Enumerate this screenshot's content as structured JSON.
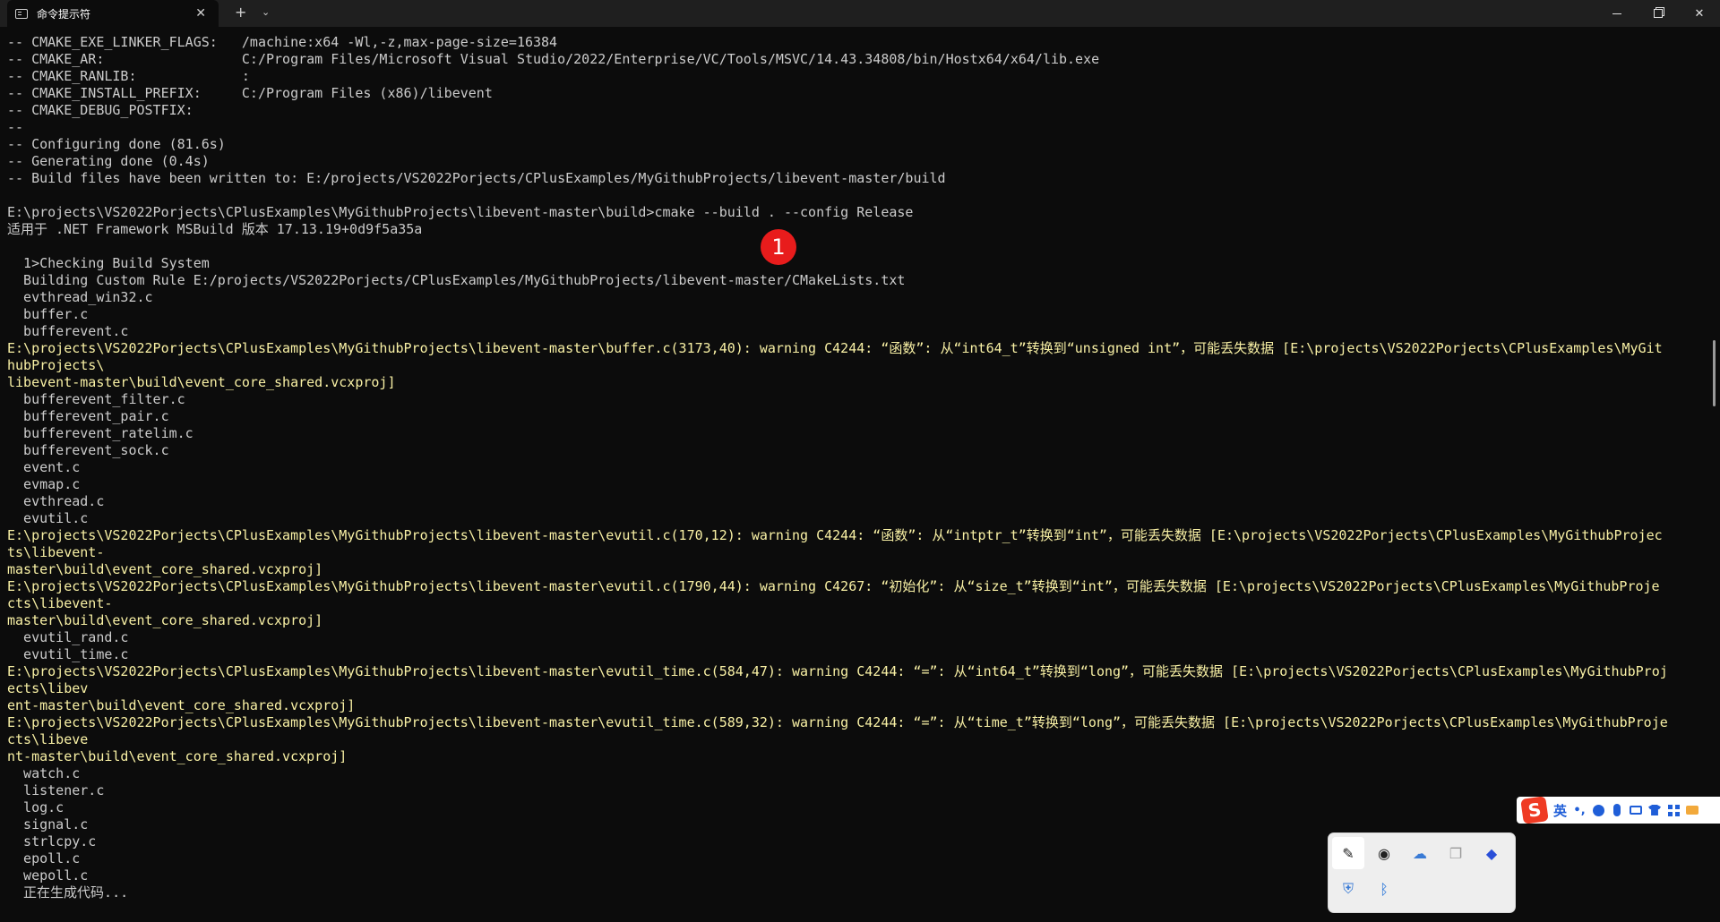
{
  "window": {
    "tab_title": "命令提示符",
    "tab_close_glyph": "✕",
    "new_tab_glyph": "+",
    "dropdown_glyph": "⌄",
    "close_glyph": "✕"
  },
  "terminal": {
    "lines": [
      {
        "text": "-- CMAKE_EXE_LINKER_FLAGS:   /machine:x64 -Wl,-z,max-page-size=16384",
        "warn": false
      },
      {
        "text": "-- CMAKE_AR:                 C:/Program Files/Microsoft Visual Studio/2022/Enterprise/VC/Tools/MSVC/14.43.34808/bin/Hostx64/x64/lib.exe",
        "warn": false
      },
      {
        "text": "-- CMAKE_RANLIB:             :",
        "warn": false
      },
      {
        "text": "-- CMAKE_INSTALL_PREFIX:     C:/Program Files (x86)/libevent",
        "warn": false
      },
      {
        "text": "-- CMAKE_DEBUG_POSTFIX:",
        "warn": false
      },
      {
        "text": "--",
        "warn": false
      },
      {
        "text": "-- Configuring done (81.6s)",
        "warn": false
      },
      {
        "text": "-- Generating done (0.4s)",
        "warn": false
      },
      {
        "text": "-- Build files have been written to: E:/projects/VS2022Porjects/CPlusExamples/MyGithubProjects/libevent-master/build",
        "warn": false
      },
      {
        "text": "",
        "warn": false
      },
      {
        "text": "E:\\projects\\VS2022Porjects\\CPlusExamples\\MyGithubProjects\\libevent-master\\build>cmake --build . --config Release",
        "warn": false
      },
      {
        "text": "适用于 .NET Framework MSBuild 版本 17.13.19+0d9f5a35a",
        "warn": false
      },
      {
        "text": "",
        "warn": false
      },
      {
        "text": "  1>Checking Build System",
        "warn": false
      },
      {
        "text": "  Building Custom Rule E:/projects/VS2022Porjects/CPlusExamples/MyGithubProjects/libevent-master/CMakeLists.txt",
        "warn": false
      },
      {
        "text": "  evthread_win32.c",
        "warn": false
      },
      {
        "text": "  buffer.c",
        "warn": false
      },
      {
        "text": "  bufferevent.c",
        "warn": false
      },
      {
        "text": "E:\\projects\\VS2022Porjects\\CPlusExamples\\MyGithubProjects\\libevent-master\\buffer.c(3173,40): warning C4244: “函数”: 从“int64_t”转换到“unsigned int”，可能丢失数据 [E:\\projects\\VS2022Porjects\\CPlusExamples\\MyGit",
        "warn": true
      },
      {
        "text": "hubProjects\\",
        "warn": true
      },
      {
        "text": "libevent-master\\build\\event_core_shared.vcxproj]",
        "warn": true
      },
      {
        "text": "  bufferevent_filter.c",
        "warn": false
      },
      {
        "text": "  bufferevent_pair.c",
        "warn": false
      },
      {
        "text": "  bufferevent_ratelim.c",
        "warn": false
      },
      {
        "text": "  bufferevent_sock.c",
        "warn": false
      },
      {
        "text": "  event.c",
        "warn": false
      },
      {
        "text": "  evmap.c",
        "warn": false
      },
      {
        "text": "  evthread.c",
        "warn": false
      },
      {
        "text": "  evutil.c",
        "warn": false
      },
      {
        "text": "E:\\projects\\VS2022Porjects\\CPlusExamples\\MyGithubProjects\\libevent-master\\evutil.c(170,12): warning C4244: “函数”: 从“intptr_t”转换到“int”，可能丢失数据 [E:\\projects\\VS2022Porjects\\CPlusExamples\\MyGithubProjec",
        "warn": true
      },
      {
        "text": "ts\\libevent-",
        "warn": true
      },
      {
        "text": "master\\build\\event_core_shared.vcxproj]",
        "warn": true
      },
      {
        "text": "E:\\projects\\VS2022Porjects\\CPlusExamples\\MyGithubProjects\\libevent-master\\evutil.c(1790,44): warning C4267: “初始化”: 从“size_t”转换到“int”，可能丢失数据 [E:\\projects\\VS2022Porjects\\CPlusExamples\\MyGithubProje",
        "warn": true
      },
      {
        "text": "cts\\libevent-",
        "warn": true
      },
      {
        "text": "master\\build\\event_core_shared.vcxproj]",
        "warn": true
      },
      {
        "text": "  evutil_rand.c",
        "warn": false
      },
      {
        "text": "  evutil_time.c",
        "warn": false
      },
      {
        "text": "E:\\projects\\VS2022Porjects\\CPlusExamples\\MyGithubProjects\\libevent-master\\evutil_time.c(584,47): warning C4244: “=”: 从“int64_t”转换到“long”，可能丢失数据 [E:\\projects\\VS2022Porjects\\CPlusExamples\\MyGithubProj",
        "warn": true
      },
      {
        "text": "ects\\libev",
        "warn": true
      },
      {
        "text": "ent-master\\build\\event_core_shared.vcxproj]",
        "warn": true
      },
      {
        "text": "E:\\projects\\VS2022Porjects\\CPlusExamples\\MyGithubProjects\\libevent-master\\evutil_time.c(589,32): warning C4244: “=”: 从“time_t”转换到“long”，可能丢失数据 [E:\\projects\\VS2022Porjects\\CPlusExamples\\MyGithubProje",
        "warn": true
      },
      {
        "text": "cts\\libeve",
        "warn": true
      },
      {
        "text": "nt-master\\build\\event_core_shared.vcxproj]",
        "warn": true
      },
      {
        "text": "  watch.c",
        "warn": false
      },
      {
        "text": "  listener.c",
        "warn": false
      },
      {
        "text": "  log.c",
        "warn": false
      },
      {
        "text": "  signal.c",
        "warn": false
      },
      {
        "text": "  strlcpy.c",
        "warn": false
      },
      {
        "text": "  epoll.c",
        "warn": false
      },
      {
        "text": "  wepoll.c",
        "warn": false
      },
      {
        "text": "  正在生成代码...",
        "warn": false
      }
    ]
  },
  "annotation": {
    "label": "1",
    "color": "#e81c1c"
  },
  "ime": {
    "logo": "S",
    "lang": "英",
    "punct": "•,"
  },
  "tray": {
    "icons": [
      {
        "name": "pen-tool-icon",
        "glyph": "✎",
        "color": "#222222",
        "selected": true
      },
      {
        "name": "steam-icon",
        "glyph": "◉",
        "color": "#222222",
        "selected": false
      },
      {
        "name": "cloud-sync-icon",
        "glyph": "☁",
        "color": "#3a7bd5",
        "selected": false
      },
      {
        "name": "window-copy-icon",
        "glyph": "❐",
        "color": "#9a9a9a",
        "selected": false
      },
      {
        "name": "app-circle-icon",
        "glyph": "◆",
        "color": "#2a4fd8",
        "selected": false
      },
      {
        "name": "security-shield-icon",
        "glyph": "⛨",
        "color": "#3a7bd5",
        "selected": false
      },
      {
        "name": "bluetooth-icon",
        "glyph": "ᛒ",
        "color": "#1f6fd8",
        "selected": false
      }
    ]
  },
  "colors": {
    "terminal_bg": "#0c0c0c",
    "terminal_text": "#cccccc",
    "warning_text": "#f9f1a5",
    "titlebar_bg": "#1f1f1f"
  }
}
